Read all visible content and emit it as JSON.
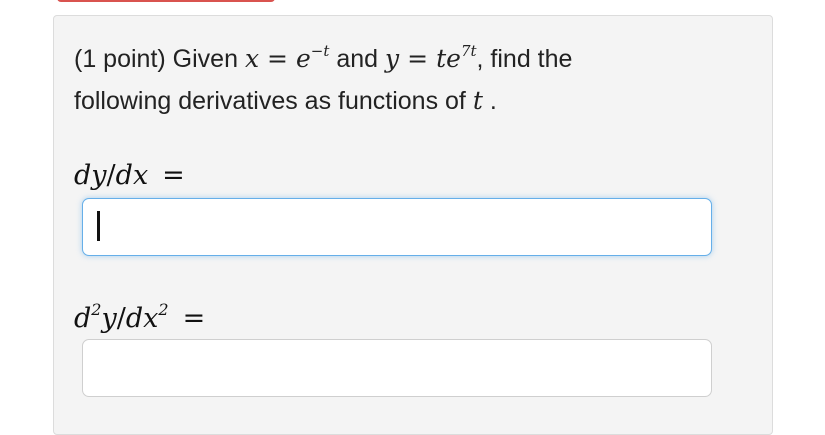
{
  "problem": {
    "points": "(1 point)",
    "given_word": "Given",
    "x_var": "x",
    "equals": "=",
    "x_base": "e",
    "x_exp": "−t",
    "and_word": "and",
    "y_var": "y",
    "y_t": "t",
    "y_base": "e",
    "y_exp": "7t",
    "find_text": ", find the",
    "line2": "following derivatives as functions of",
    "t_var": "t",
    "period": " ."
  },
  "answers": [
    {
      "label_d1": "dy",
      "label_slash": "/",
      "label_d2": "dx",
      "equals": "=",
      "value": ""
    },
    {
      "label_num_d": "d",
      "label_num_exp": "2",
      "label_num_y": "y",
      "label_slash": "/",
      "label_den_dx": "dx",
      "label_den_exp": "2",
      "equals": "=",
      "value": ""
    }
  ],
  "colors": {
    "card_bg": "#f4f4f4",
    "focus_border": "#66afe9",
    "accent": "#d9534f"
  }
}
